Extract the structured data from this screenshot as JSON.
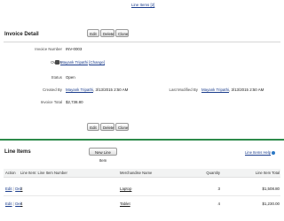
{
  "top_link": "Line Items [2]",
  "invoice": {
    "title": "Invoice Detail",
    "buttons": {
      "edit": "Edit",
      "delete": "Delete",
      "clone": "Clone"
    },
    "fields": {
      "invoice_number_label": "Invoice Number",
      "invoice_number_value": "INV-0003",
      "owner_label": "Owner",
      "owner_value": "Mayank Tripathi",
      "owner_change": "[Change]",
      "status_label": "Status",
      "status_value": "Open",
      "created_by_label": "Created By",
      "created_by_user": "Mayank Tripathi",
      "created_by_date": ", 3/13/2015 2:50 AM",
      "last_modified_label": "Last Modified By",
      "last_modified_user": "Mayank Tripathi",
      "last_modified_date": ", 3/13/2015 2:50 AM",
      "invoice_total_label": "Invoice Total",
      "invoice_total_value": "$2,738.80"
    }
  },
  "line_items": {
    "title": "Line Items",
    "new_button": "New Line Item",
    "help_link": "Line Items Help",
    "columns": [
      "Action",
      "Line Item: Line Item Number",
      "Merchandise Name",
      "Quantity",
      "Line Item Total"
    ],
    "rows": [
      {
        "edit": "Edit",
        "del": "Del",
        "number": "2",
        "merchandise": "Laptop",
        "quantity": "3",
        "total": "$1,508.80"
      },
      {
        "edit": "Edit",
        "del": "Del",
        "number": "4",
        "merchandise": "Tablet",
        "quantity": "4",
        "total": "$1,230.00"
      }
    ]
  },
  "colors": {
    "accent": "#2d8a4a",
    "link": "#1a3c8c"
  }
}
